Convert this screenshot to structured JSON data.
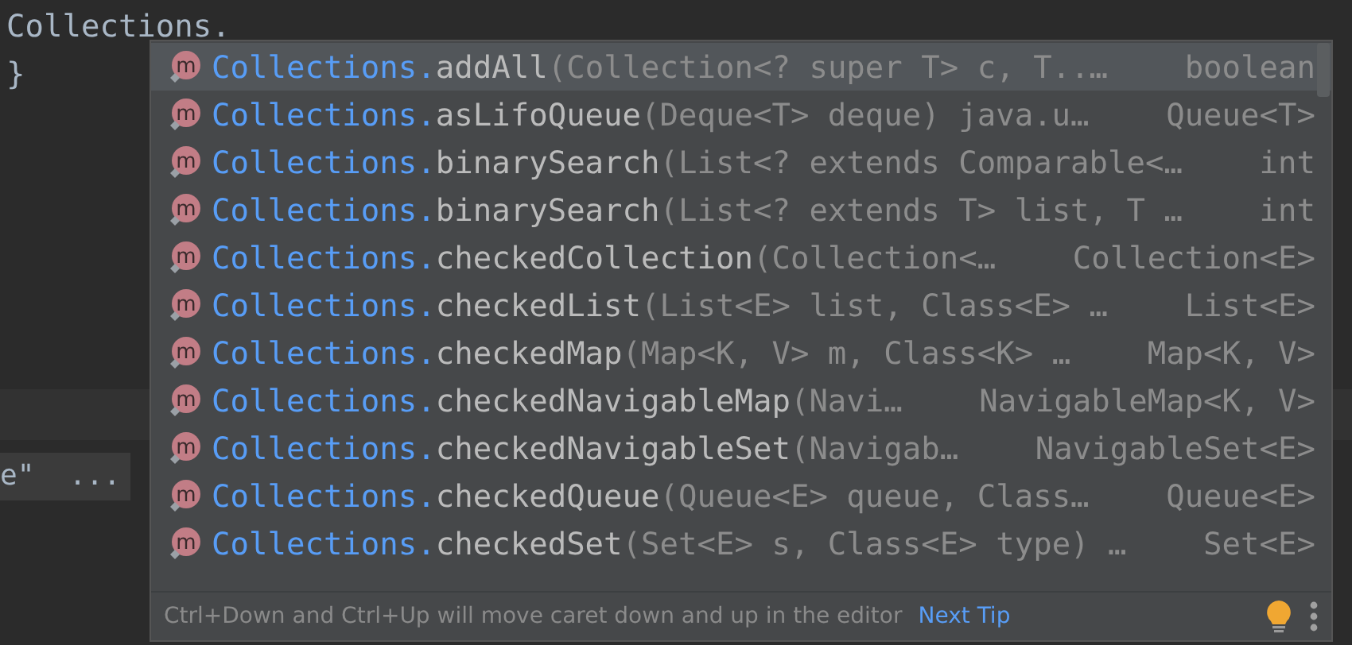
{
  "editor": {
    "lines": [
      {
        "text": "Collections."
      },
      {
        "text": "}"
      }
    ],
    "folded_text": "e\"  ..."
  },
  "completion": {
    "items": [
      {
        "icon_letter": "m",
        "qualifier": "Collections.",
        "name": "addAll",
        "params": "(Collection<? super T> c, T..…",
        "type": "boolean",
        "selected": true
      },
      {
        "icon_letter": "m",
        "qualifier": "Collections.",
        "name": "asLifoQueue",
        "params": "(Deque<T> deque) java.u…",
        "type": "Queue<T>",
        "selected": false
      },
      {
        "icon_letter": "m",
        "qualifier": "Collections.",
        "name": "binarySearch",
        "params": "(List<? extends Comparable<…",
        "type": "int",
        "selected": false
      },
      {
        "icon_letter": "m",
        "qualifier": "Collections.",
        "name": "binarySearch",
        "params": "(List<? extends T> list, T …",
        "type": "int",
        "selected": false
      },
      {
        "icon_letter": "m",
        "qualifier": "Collections.",
        "name": "checkedCollection",
        "params": "(Collection<…",
        "type": "Collection<E>",
        "selected": false
      },
      {
        "icon_letter": "m",
        "qualifier": "Collections.",
        "name": "checkedList",
        "params": "(List<E> list, Class<E> …",
        "type": "List<E>",
        "selected": false
      },
      {
        "icon_letter": "m",
        "qualifier": "Collections.",
        "name": "checkedMap",
        "params": "(Map<K, V> m, Class<K> …",
        "type": "Map<K, V>",
        "selected": false
      },
      {
        "icon_letter": "m",
        "qualifier": "Collections.",
        "name": "checkedNavigableMap",
        "params": "(Navi…",
        "type": "NavigableMap<K, V>",
        "selected": false
      },
      {
        "icon_letter": "m",
        "qualifier": "Collections.",
        "name": "checkedNavigableSet",
        "params": "(Navigab…",
        "type": "NavigableSet<E>",
        "selected": false
      },
      {
        "icon_letter": "m",
        "qualifier": "Collections.",
        "name": "checkedQueue",
        "params": "(Queue<E> queue, Class…",
        "type": "Queue<E>",
        "selected": false
      },
      {
        "icon_letter": "m",
        "qualifier": "Collections.",
        "name": "checkedSet",
        "params": "(Set<E> s, Class<E> type) …",
        "type": "Set<E>",
        "selected": false
      }
    ],
    "tip": {
      "text": "Ctrl+Down and Ctrl+Up will move caret down and up in the editor",
      "link": "Next Tip"
    }
  }
}
